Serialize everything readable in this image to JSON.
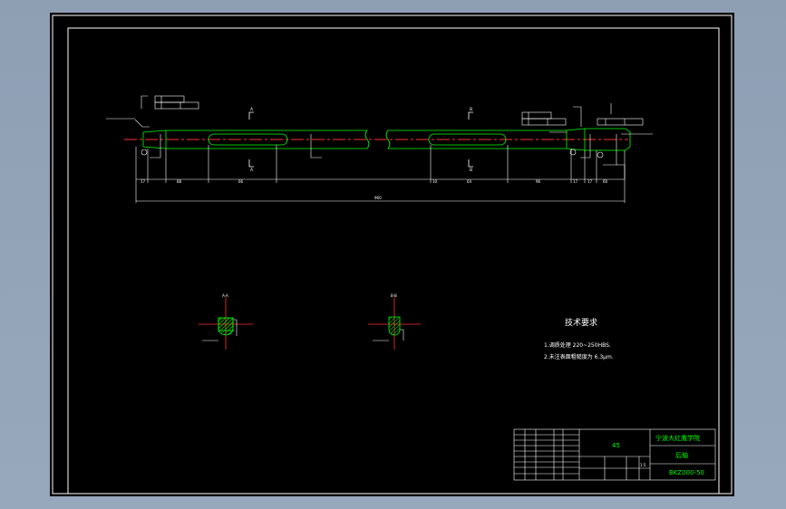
{
  "tech_requirements": {
    "title": "技术要求",
    "line1": "1.调质处理 220~250HBS.",
    "line2": "2.未注表面粗糙度为 6.3μm."
  },
  "section_labels": {
    "a": "A-A",
    "b": "B-B"
  },
  "cut_marks": {
    "a_top": "A",
    "a_bottom": "A",
    "b_top": "B",
    "b_bottom": "B"
  },
  "title_block": {
    "school": "宁波大红鹰学院",
    "part_name": "后轴",
    "drawing_no": "BKZ000-50",
    "material": "45",
    "scale": "1:5"
  },
  "dimensions": {
    "overall": "960"
  },
  "colors": {
    "sheet": "#000000",
    "outline": "#ffffff",
    "shaft": "#00ff00",
    "centerline": "#ff0000",
    "annotation": "#ffffff"
  }
}
